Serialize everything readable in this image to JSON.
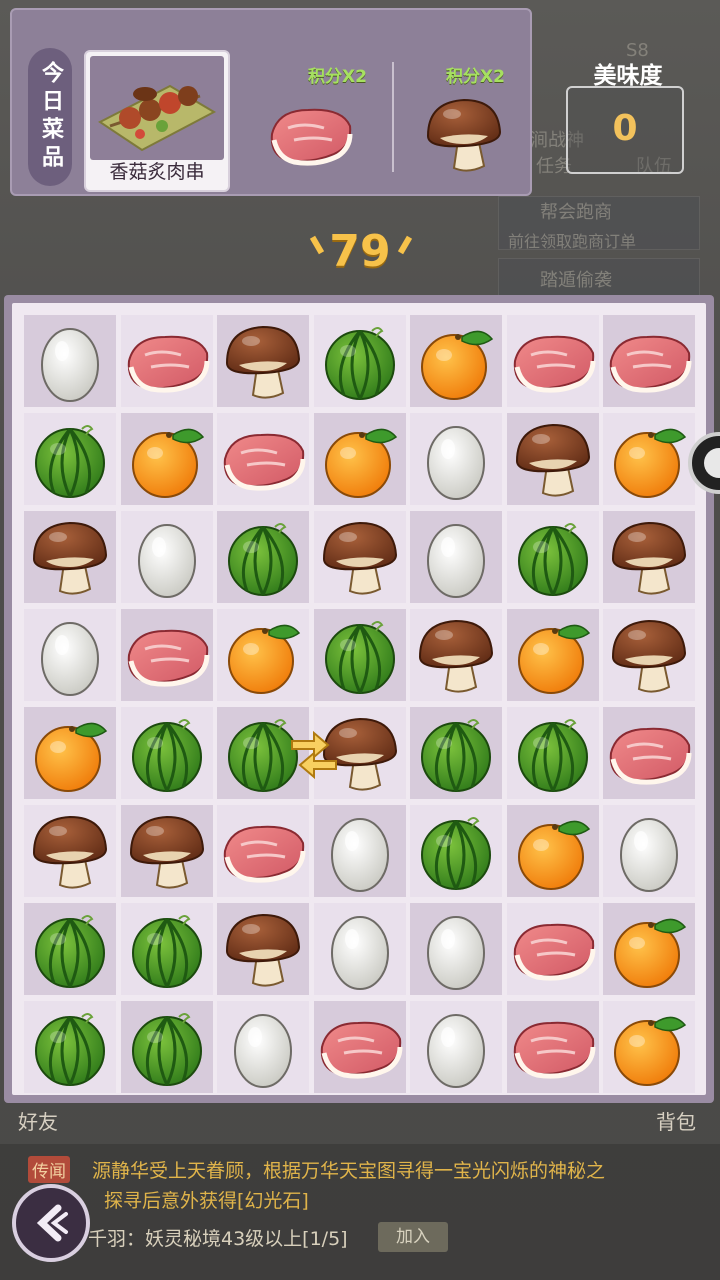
{
  "header": {
    "today_label": "今日菜品",
    "dish_name": "香菇炙肉串",
    "bonus_1": "积分X2",
    "bonus_2": "积分X2",
    "taste_title": "美味度",
    "taste_value": "0",
    "moves_left": "79"
  },
  "background_ui": {
    "level": "S8",
    "task": "任务",
    "team": "队伍",
    "task_1": "帮会跑商",
    "task_1_sub": "前往领取跑商订单",
    "task_2": "踏遁偷袭",
    "event_text": "云涧战神"
  },
  "board": {
    "rows": 8,
    "cols": 7,
    "tiles": [
      [
        "egg",
        "meat",
        "mushroom",
        "melon",
        "orange",
        "meat",
        "meat"
      ],
      [
        "melon",
        "orange",
        "meat",
        "orange",
        "egg",
        "mushroom",
        "orange"
      ],
      [
        "mushroom",
        "egg",
        "melon",
        "mushroom",
        "egg",
        "melon",
        "mushroom"
      ],
      [
        "egg",
        "meat",
        "orange",
        "melon",
        "mushroom",
        "orange",
        "mushroom"
      ],
      [
        "orange",
        "melon",
        "melon",
        "mushroom",
        "melon",
        "melon",
        "meat"
      ],
      [
        "mushroom",
        "mushroom",
        "meat",
        "egg",
        "melon",
        "orange",
        "egg"
      ],
      [
        "melon",
        "melon",
        "mushroom",
        "egg",
        "egg",
        "meat",
        "orange"
      ],
      [
        "melon",
        "melon",
        "egg",
        "meat",
        "egg",
        "meat",
        "orange"
      ]
    ],
    "hint": {
      "row": 4,
      "from_col": 2,
      "to_col": 3,
      "icon": "swap-arrows-icon"
    }
  },
  "bottom": {
    "friends": "好友",
    "bag": "背包",
    "chat_tag": "传闻",
    "chat_line_1": "源静华受上天眷顾，根据万华天宝图寻得一宝光闪烁的神秘之",
    "chat_line_2": "探寻后意外获得[幻光石]",
    "chat_line_3": "千羽：妖灵秘境43级以上[1/5]",
    "join_label": "加入"
  },
  "colors": {
    "panel": "#8d8098",
    "board_frame": "#9a8ca3",
    "cell_dark": "#d7cbdb",
    "cell_light": "#e9e0ec",
    "moves": "#f7c24a",
    "bonus": "#a6e060"
  }
}
